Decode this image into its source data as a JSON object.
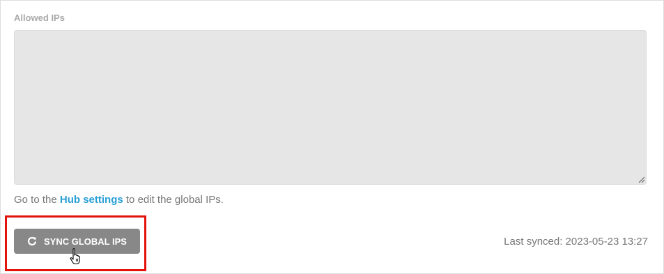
{
  "allowed_ips": {
    "label": "Allowed IPs",
    "value": ""
  },
  "help": {
    "prefix": "Go to the ",
    "link_text": "Hub settings",
    "suffix": " to edit the global IPs."
  },
  "sync_button": {
    "label": "SYNC GLOBAL IPS",
    "icon": "refresh-icon"
  },
  "last_synced": {
    "label": "Last synced: 2023-05-23 13:27"
  },
  "colors": {
    "link": "#2a9fd6",
    "button_bg": "#888888",
    "highlight": "#e3120b",
    "textarea_bg": "#e6e6e6"
  }
}
